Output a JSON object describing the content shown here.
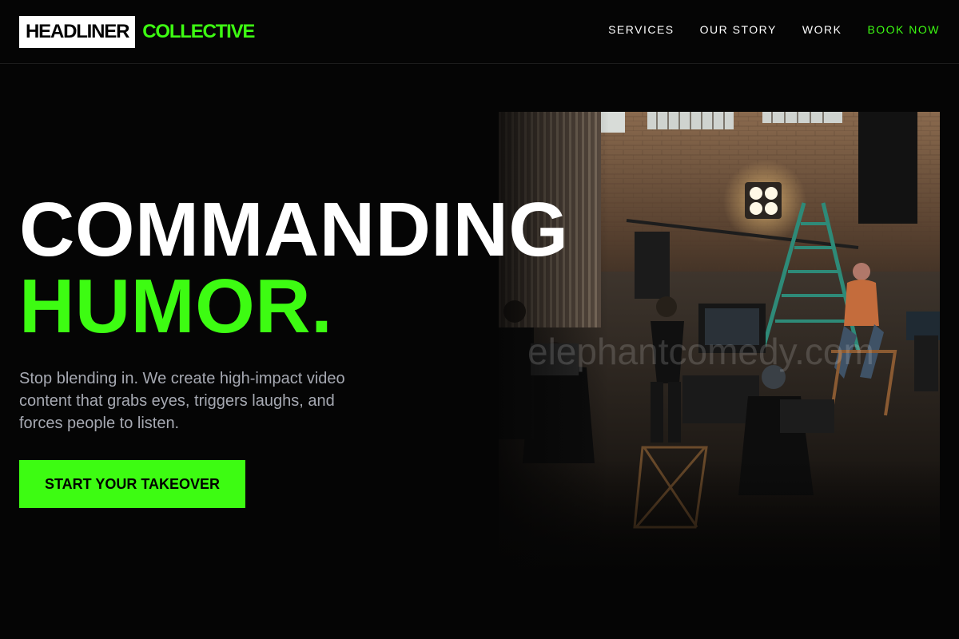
{
  "header": {
    "logo_box": "HEADLINER",
    "logo_text": "COLLECTIVE",
    "nav": {
      "services": "SERVICES",
      "our_story": "OUR STORY",
      "work": "WORK",
      "book_now": "BOOK NOW"
    }
  },
  "hero": {
    "headline_line1": "COMMANDING",
    "headline_line2": "HUMOR.",
    "lede": "Stop blending in. We create high-impact video content that grabs eyes, triggers laughs, and forces people to listen.",
    "cta_label": "START YOUR TAKEOVER"
  },
  "image": {
    "alt": "Film crew shooting an interview in a brick warehouse studio",
    "watermark": "elephantcomedy.com"
  },
  "colors": {
    "accent": "#3dfc12",
    "background": "#050505",
    "body_text": "#a6a9b2"
  }
}
